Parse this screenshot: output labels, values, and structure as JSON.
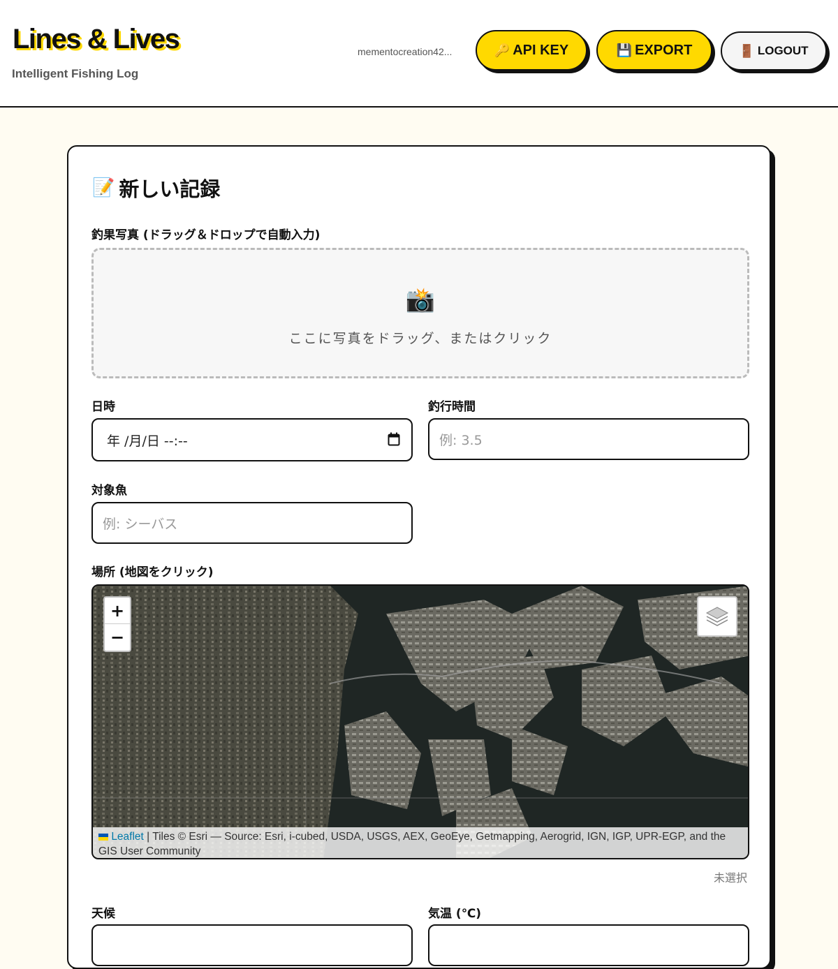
{
  "header": {
    "logo": "Lines & Lives",
    "tagline": "Intelligent Fishing Log",
    "user_email": "mementocreation42...",
    "api_key_label": "API KEY",
    "export_label": "EXPORT",
    "logout_label": "LOGOUT"
  },
  "form": {
    "title": "新しい記録",
    "photo": {
      "label": "釣果写真 (ドラッグ＆ドロップで自動入力)",
      "dropzone_text": "ここに写真をドラッグ、またはクリック"
    },
    "datetime": {
      "label": "日時",
      "value": "年 /月/日 --:--"
    },
    "duration": {
      "label": "釣行時間",
      "placeholder": "例: 3.5"
    },
    "species": {
      "label": "対象魚",
      "placeholder": "例: シーバス"
    },
    "location": {
      "label": "場所 (地図をクリック)",
      "zoom_in": "+",
      "zoom_out": "−",
      "attribution_leaflet": "Leaflet",
      "attribution_text": " | Tiles © Esri — Source: Esri, i-cubed, USDA, USGS, AEX, GeoEye, Getmapping, Aerogrid, IGN, IGP, UPR-EGP, and the GIS User Community",
      "status": "未選択"
    },
    "weather": {
      "label": "天候"
    },
    "temperature": {
      "label": "気温 (℃)"
    }
  },
  "icons": {
    "api_key": "key-icon",
    "export": "floppy-disk-icon",
    "logout": "door-icon",
    "title": "memo-icon",
    "dropzone": "camera-flash-icon"
  },
  "colors": {
    "accent": "#ffd900",
    "background": "#fffcf2",
    "border": "#111111"
  }
}
